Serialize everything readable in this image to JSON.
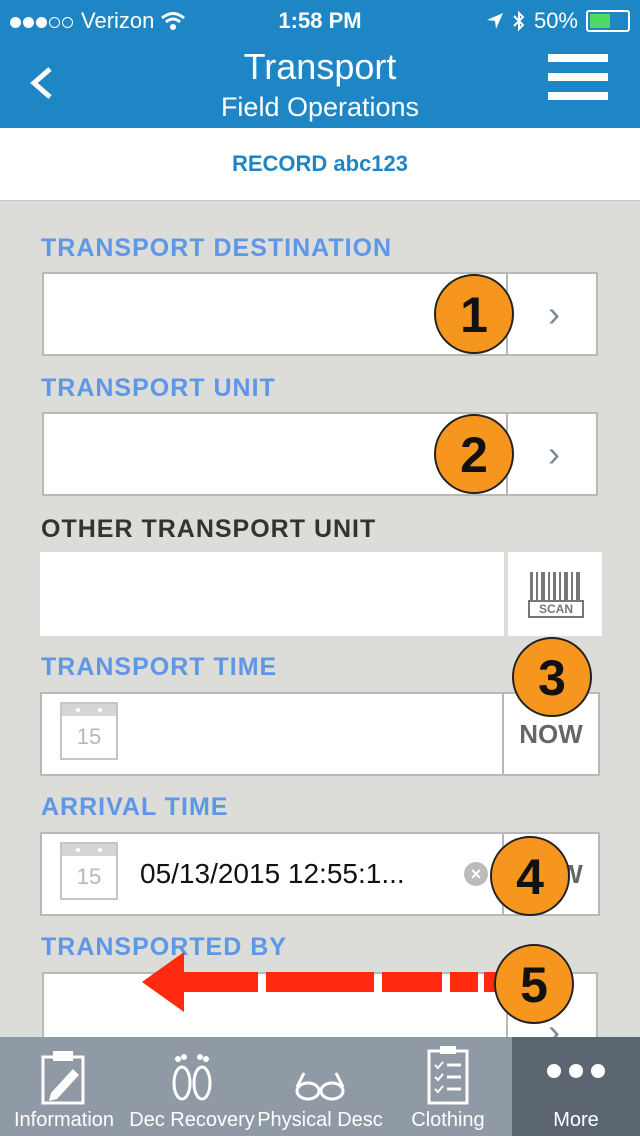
{
  "status": {
    "carrier": "Verizon",
    "time": "1:58 PM",
    "battery": "50%"
  },
  "nav": {
    "title": "Transport",
    "subtitle": "Field Operations",
    "back_icon": "chevron-left-icon",
    "menu_icon": "hamburger-menu-icon"
  },
  "record": {
    "label": "RECORD abc123"
  },
  "fields": {
    "destination": {
      "label": "TRANSPORT DESTINATION",
      "value": ""
    },
    "unit": {
      "label": "TRANSPORT UNIT",
      "value": ""
    },
    "other_unit": {
      "label": "OTHER TRANSPORT UNIT",
      "value": "",
      "scan_label": "SCAN"
    },
    "transport_time": {
      "label": "TRANSPORT TIME",
      "value": "",
      "cal_day": "15",
      "now_label": "NOW"
    },
    "arrival_time": {
      "label": "ARRIVAL TIME",
      "value": "05/13/2015 12:55:1...",
      "cal_day": "15",
      "now_label": "NOW"
    },
    "transported_by": {
      "label": "TRANSPORTED BY",
      "value": ""
    }
  },
  "markers": [
    "1",
    "2",
    "3",
    "4",
    "5"
  ],
  "tabs": [
    {
      "label": "Information",
      "icon": "clipboard-pen-icon"
    },
    {
      "label": "Dec Recovery",
      "icon": "footprints-icon"
    },
    {
      "label": "Physical Desc",
      "icon": "glasses-icon"
    },
    {
      "label": "Clothing",
      "icon": "checklist-icon"
    },
    {
      "label": "More",
      "icon": "more-dots-icon"
    }
  ],
  "colors": {
    "accent": "#1f86c6",
    "label_blue": "#5e97e8",
    "marker": "#f7961e",
    "arrow": "#ff2a0f"
  }
}
